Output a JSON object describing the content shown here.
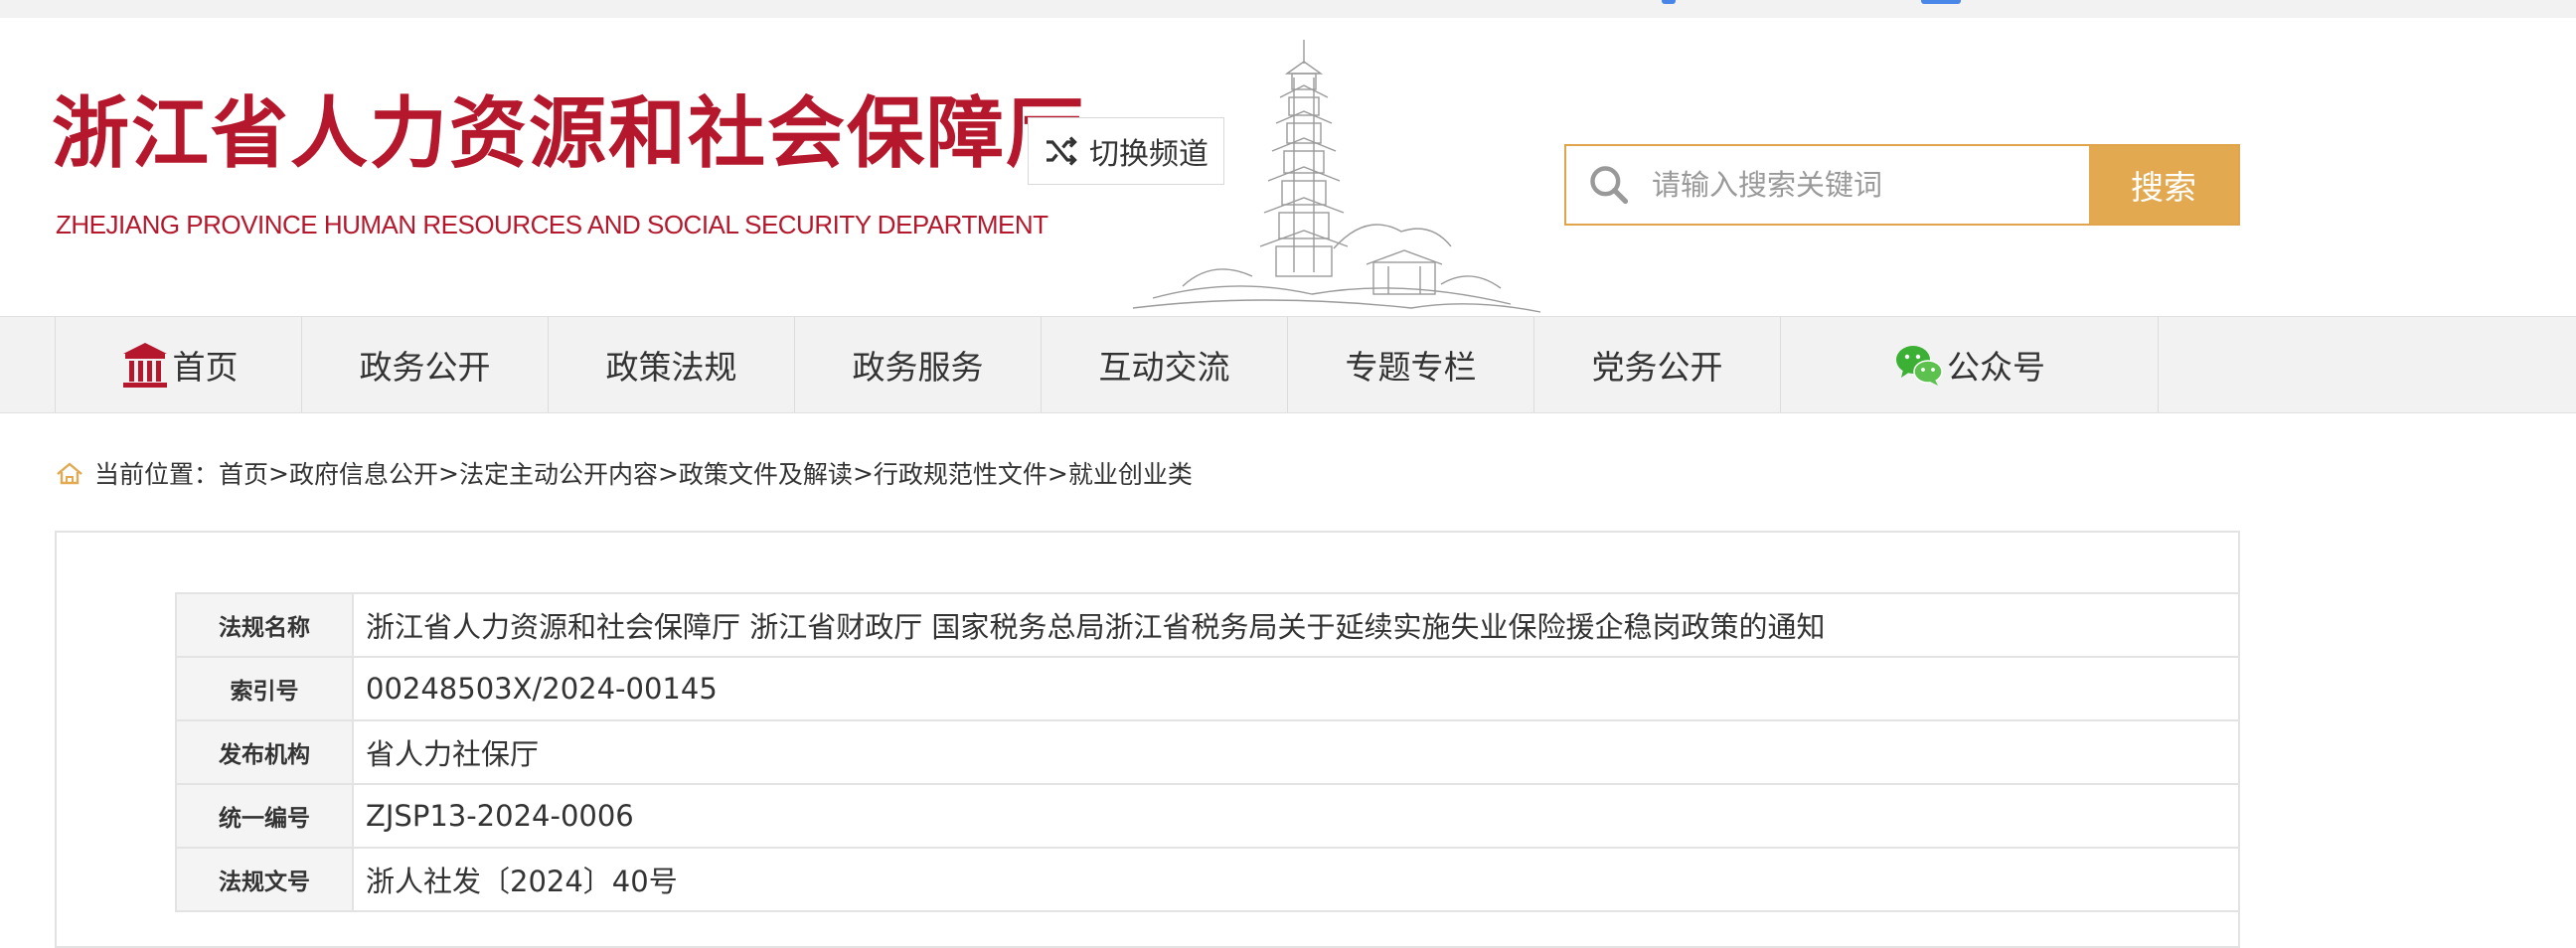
{
  "header": {
    "title_cn": "浙江省人力资源和社会保障厅",
    "title_en": "ZHEJIANG PROVINCE HUMAN RESOURCES AND SOCIAL SECURITY DEPARTMENT",
    "switch_channel": "切换频道",
    "brand_color": "#b5182c"
  },
  "search": {
    "placeholder": "请输入搜索关键词",
    "button": "搜索",
    "accent_color": "#e3a950"
  },
  "nav": {
    "home": "首页",
    "items": [
      "政务公开",
      "政策法规",
      "政务服务",
      "互动交流",
      "专题专栏",
      "党务公开"
    ],
    "wechat": "公众号"
  },
  "breadcrumb": {
    "prefix": "当前位置：",
    "items": [
      "首页",
      "政府信息公开",
      "法定主动公开内容",
      "政策文件及解读",
      "行政规范性文件",
      "就业创业类"
    ],
    "separator": ">"
  },
  "document": {
    "rows": [
      {
        "label": "法规名称",
        "value": "浙江省人力资源和社会保障厅 浙江省财政厅 国家税务总局浙江省税务局关于延续实施失业保险援企稳岗政策的通知"
      },
      {
        "label": "索引号",
        "value": "00248503X/2024-00145"
      },
      {
        "label": "发布机构",
        "value": "省人力社保厅"
      },
      {
        "label": "统一编号",
        "value": "ZJSP13-2024-0006"
      },
      {
        "label": "法规文号",
        "value": "浙人社发〔2024〕40号"
      }
    ]
  }
}
